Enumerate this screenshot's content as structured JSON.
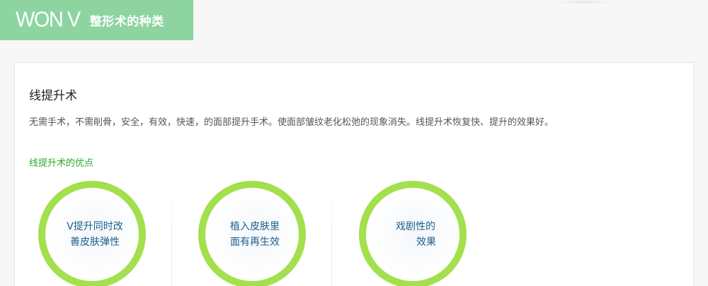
{
  "header": {
    "brand": "WON V",
    "subtitle": "整形术的种类"
  },
  "card": {
    "title": "线提升术",
    "description": "无需手术，不需削骨，安全，有效，快速，的面部提升手术。使面部皱纹老化松弛的现象消失。线提升术恢复快、提升的效果好。",
    "section_title": "线提升术的优点",
    "features": [
      {
        "line1": "V提升同时改",
        "line2": "善皮肤弹性"
      },
      {
        "line1": "植入皮肤里",
        "line2": "面有再生效"
      },
      {
        "line1": "戏剧性的",
        "line2": "效果"
      }
    ]
  },
  "colors": {
    "header_bg": "#8dd4a1",
    "ring": "#a2e04e",
    "section_title": "#2ba72e",
    "feature_text": "#1d5f8d"
  }
}
